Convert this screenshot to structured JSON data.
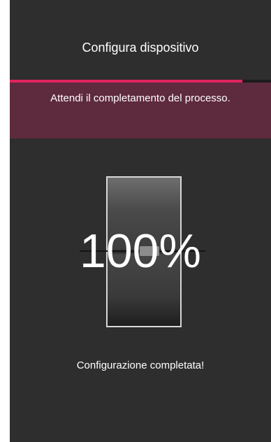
{
  "header": {
    "title": "Configura dispositivo"
  },
  "progress": {
    "fraction": 0.89,
    "color": "#e0245e"
  },
  "banner": {
    "message": "Attendi il completamento del processo.",
    "color": "#5e2a3e"
  },
  "device": {
    "percent_label": "100%",
    "icon": "wall-switch-icon"
  },
  "status": {
    "message": "Configurazione completata!"
  }
}
